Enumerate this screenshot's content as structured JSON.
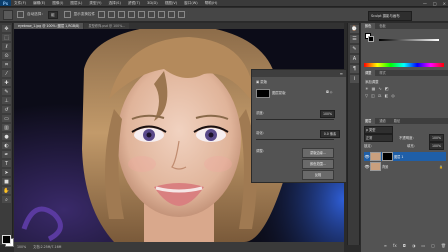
{
  "menu": {
    "logo": "Ps",
    "items": [
      "文件(F)",
      "编辑(E)",
      "图像(I)",
      "图层(L)",
      "类型(Y)",
      "选择(S)",
      "滤镜(T)",
      "3D(D)",
      "视图(V)",
      "窗口(W)",
      "帮助(H)"
    ],
    "window_controls": [
      "—",
      "□",
      "×"
    ]
  },
  "options": {
    "auto_select_label": "自动选择：",
    "auto_select_value": "组",
    "show_transform_label": "显示变换控件",
    "workspace": "Sculpt 摄影与画布"
  },
  "tabs": [
    {
      "label": "eyebrow_1.jpg @ 100% (图层 1,RGB/8)"
    },
    {
      "label": "发型修饰.psd @ 100%..."
    }
  ],
  "status": {
    "zoom": "100%",
    "doc": "文档:2.25M/7.16M"
  },
  "properties": {
    "title_icon": "蒙版",
    "mask_label": "图层蒙版",
    "density_label": "浓度：",
    "density_value": "100%",
    "feather_label": "羽化：",
    "feather_value": "0.0 像素",
    "adjust_label": "调整：",
    "buttons": [
      "蒙版边缘...",
      "颜色范围...",
      "反相"
    ]
  },
  "right_panel": {
    "color_tabs": [
      "颜色",
      "色板"
    ],
    "adjust_tabs": [
      "调整",
      "样式"
    ],
    "adjust_title": "添加调整",
    "layers_tabs": [
      "图层",
      "通道",
      "路径"
    ],
    "kind_label": "ρ 类型",
    "blend_mode": "正常",
    "opacity_label": "不透明度：",
    "opacity_value": "100%",
    "lock_label": "锁定：",
    "fill_label": "填充：",
    "fill_value": "100%",
    "layers": [
      {
        "name": "图层 1",
        "thumb_color": "#c9a07e",
        "mask": true
      },
      {
        "name": "背景",
        "thumb_color": "#c9a07e",
        "mask": false
      }
    ]
  },
  "colors": {
    "accent": "#1f5fa8",
    "panel": "#535353",
    "dark": "#3a3a3a"
  }
}
